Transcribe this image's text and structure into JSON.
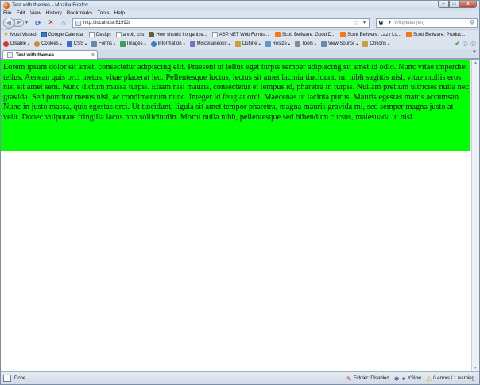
{
  "window": {
    "title": "Test with themes - Mozilla Firefox",
    "controls": {
      "minimize": "–",
      "maximize": "□",
      "close": "x"
    }
  },
  "menu": [
    "File",
    "Edit",
    "View",
    "History",
    "Bookmarks",
    "Tools",
    "Help"
  ],
  "nav": {
    "url": "http://localhost:61992/",
    "search_placeholder": "Wikipedia (en)",
    "search_engine": "W"
  },
  "bookmarks": [
    {
      "label": "Most Visited",
      "icon": "star"
    },
    {
      "label": "Google Calendar",
      "icon": "gcal"
    },
    {
      "label": "Design",
      "icon": "doc"
    },
    {
      "label": "a voir, css",
      "icon": "doc"
    },
    {
      "label": "How should I organize...",
      "icon": "hat"
    },
    {
      "label": "ASP.NET Web Forms ...",
      "icon": "doc"
    },
    {
      "label": "Scott Bellware: Good D...",
      "icon": "rss"
    },
    {
      "label": "Scott Bellware: Lazy Lo...",
      "icon": "rss"
    },
    {
      "label": "Scott Bellware: Produc...",
      "icon": "rss"
    }
  ],
  "devtoolbar": [
    {
      "label": "Disable",
      "color": "#d33a2a"
    },
    {
      "label": "Cookies",
      "color": "#c88a3a"
    },
    {
      "label": "CSS",
      "color": "#3a6fc9"
    },
    {
      "label": "Forms",
      "color": "#6a8aa8"
    },
    {
      "label": "Images",
      "color": "#3aa05a"
    },
    {
      "label": "Information",
      "color": "#3a7fc9"
    },
    {
      "label": "Miscellaneous",
      "color": "#8a6ac9"
    },
    {
      "label": "Outline",
      "color": "#c9a03a"
    },
    {
      "label": "Resize",
      "color": "#5a9ac9"
    },
    {
      "label": "Tools",
      "color": "#8a8a8a"
    },
    {
      "label": "View Source",
      "color": "#6a8aa8"
    },
    {
      "label": "Options",
      "color": "#c9a03a"
    }
  ],
  "tab": {
    "label": "Test with themes"
  },
  "content": {
    "paragraph": "Lorem ipsum dolor sit amet, consectetur adipiscing elit. Praesent ut tellus eget turpis semper adipiscing sit amet id odio. Nunc vitae imperdiet tellus. Aenean quis orci metus, vitae placerat leo. Pellentesque luctus, lectus sit amet lacinia tincidunt, mi nibh sagittis nisl, vitae mollis eros nisi sit amet sem. Nunc dictum massa turpis. Etiam nisi mauris, consectetur et tempus id, pharetra in turpis. Nullam pretium ultricies nulla nec gravida. Sed porttitor metus nisl, ac condimentum nunc. Integer id feugiat orci. Maecenas ut lacinia purus. Mauris egestas mattis accumsan. Nunc in justo massa, quis egestas orci. Ut tincidunt, ligula sit amet tempor pharetra, magna mauris gravida mi, sed semper magna justo at velit. Donec vulputate fringilla lacus non sollicitudin. Morbi nulla nibh, pellentesque sed bibendum cursus, malesuada ut nisi.",
    "background": "#00ff00"
  },
  "status": {
    "text": "Done",
    "fiddler": "Fiddler: Disabled",
    "yslow": "YSlow",
    "errors": "0 errors / 1 warning"
  }
}
